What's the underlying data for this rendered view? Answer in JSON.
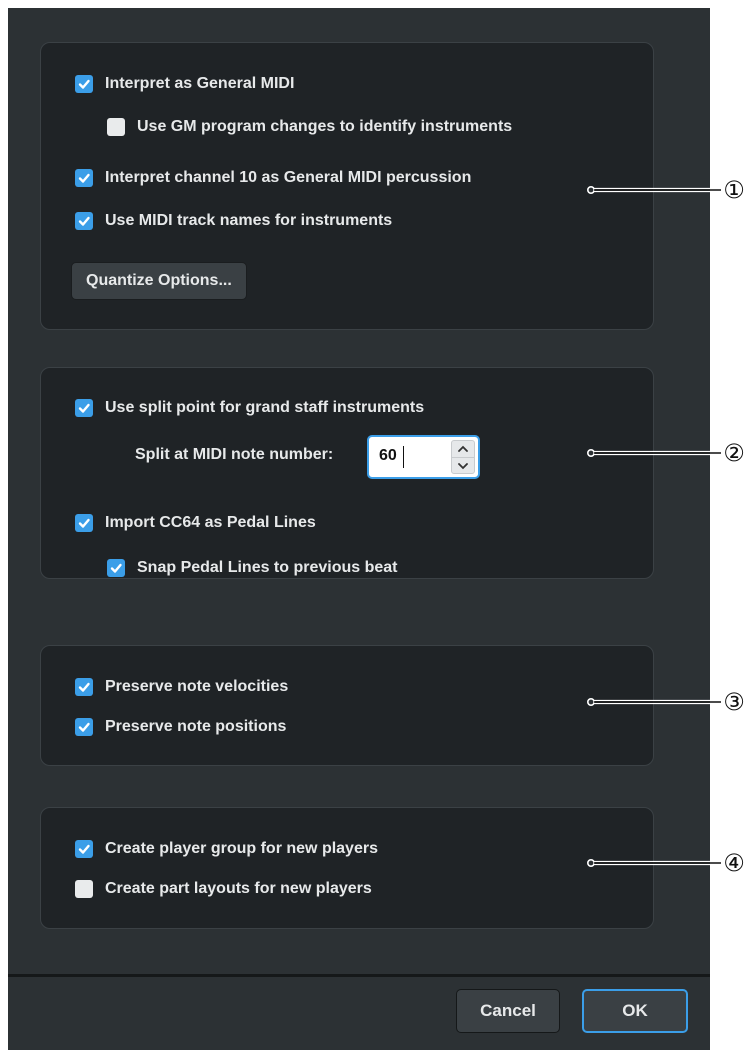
{
  "colors": {
    "accent": "#3b9ee8",
    "dialog_bg": "#2c3134",
    "group_bg": "#1f2326",
    "text": "#e7e9ea"
  },
  "group1": {
    "interpret_gm": {
      "label": "Interpret as General MIDI",
      "checked": true
    },
    "use_gm_program": {
      "label": "Use GM program changes to identify instruments",
      "checked": false
    },
    "interpret_ch10": {
      "label": "Interpret channel 10 as General MIDI percussion",
      "checked": true
    },
    "use_track_names": {
      "label": "Use MIDI track names for instruments",
      "checked": true
    },
    "quantize_button": "Quantize Options..."
  },
  "group2": {
    "use_split_point": {
      "label": "Use split point for grand staff instruments",
      "checked": true
    },
    "split_label": "Split at MIDI note number:",
    "split_value": "60",
    "import_cc64": {
      "label": "Import CC64 as Pedal Lines",
      "checked": true
    },
    "snap_pedal": {
      "label": "Snap Pedal Lines to previous beat",
      "checked": true
    }
  },
  "group3": {
    "preserve_velocities": {
      "label": "Preserve note velocities",
      "checked": true
    },
    "preserve_positions": {
      "label": "Preserve note positions",
      "checked": true
    }
  },
  "group4": {
    "create_player_group": {
      "label": "Create player group for new players",
      "checked": true
    },
    "create_part_layouts": {
      "label": "Create part layouts for new players",
      "checked": false
    }
  },
  "footer": {
    "cancel": "Cancel",
    "ok": "OK"
  },
  "callouts": [
    "①",
    "②",
    "③",
    "④"
  ]
}
